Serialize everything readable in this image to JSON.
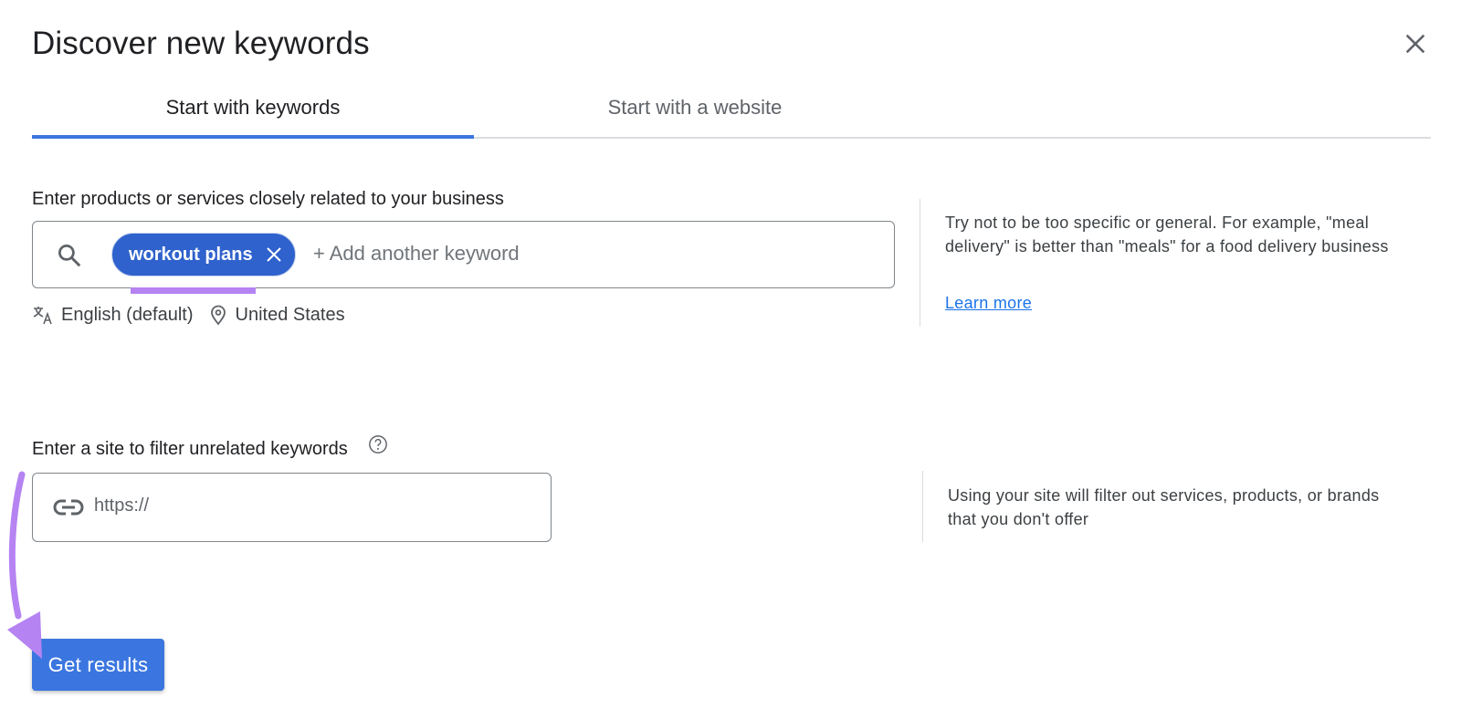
{
  "dialog": {
    "title": "Discover new keywords",
    "close_icon": "close-icon"
  },
  "tabs": [
    {
      "label": "Start with keywords",
      "active": true
    },
    {
      "label": "Start with a website",
      "active": false
    }
  ],
  "keywords_section": {
    "label": "Enter products or services closely related to your business",
    "search_icon": "search-icon",
    "chips": [
      {
        "label": "workout plans",
        "remove_icon": "close-icon"
      }
    ],
    "add_placeholder": "+ Add another keyword",
    "language": {
      "icon": "translate-icon",
      "label": "English (default)"
    },
    "location": {
      "icon": "location-pin-icon",
      "label": "United States"
    },
    "help": {
      "text": "Try not to be too specific or general. For example, \"meal delivery\" is better than \"meals\" for a food delivery business",
      "link_label": "Learn more"
    }
  },
  "site_section": {
    "label": "Enter a site to filter unrelated keywords",
    "help_icon": "help-circle-icon",
    "link_icon": "link-icon",
    "placeholder": "https://",
    "value": "",
    "help_text": "Using your site will filter out services, products, or brands that you don't offer"
  },
  "actions": {
    "submit_label": "Get results"
  },
  "annotations": {
    "highlight_color": "#b583f2",
    "arrow_color": "#b583f2"
  },
  "colors": {
    "accent": "#3b76e0",
    "chip": "#2f62cc",
    "link": "#1a73e8"
  }
}
